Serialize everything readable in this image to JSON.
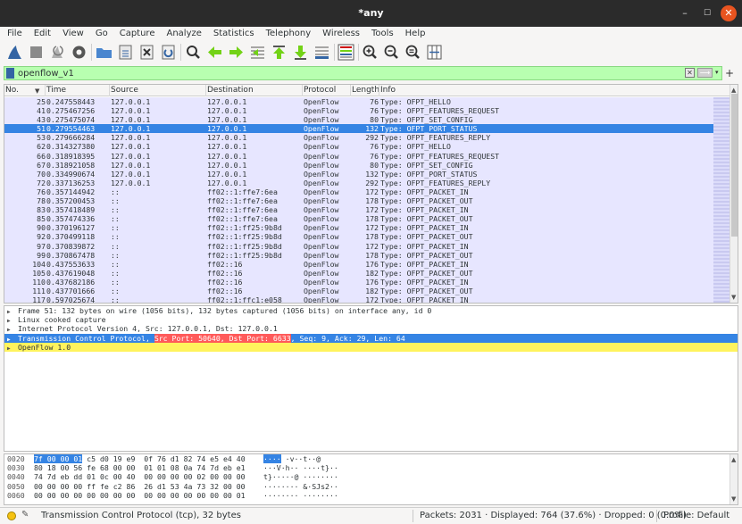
{
  "window": {
    "title": "*any",
    "min": "–",
    "max": "☐",
    "close": "✕"
  },
  "menu": [
    "File",
    "Edit",
    "View",
    "Go",
    "Capture",
    "Analyze",
    "Statistics",
    "Telephony",
    "Wireless",
    "Tools",
    "Help"
  ],
  "filter": {
    "value": "openflow_v1",
    "add": "+",
    "clear": "✕",
    "apply": "⟶",
    "dropdown": "▾"
  },
  "columns": {
    "no": "No.",
    "time": "Time",
    "source": "Source",
    "destination": "Destination",
    "protocol": "Protocol",
    "length": "Length",
    "info": "Info"
  },
  "packets": [
    {
      "no": "25",
      "time": "0.247558443",
      "src": "127.0.0.1",
      "dst": "127.0.0.1",
      "proto": "OpenFlow",
      "len": "76",
      "info": "Type: OFPT_HELLO"
    },
    {
      "no": "41",
      "time": "0.275467256",
      "src": "127.0.0.1",
      "dst": "127.0.0.1",
      "proto": "OpenFlow",
      "len": "76",
      "info": "Type: OFPT_FEATURES_REQUEST"
    },
    {
      "no": "43",
      "time": "0.275475074",
      "src": "127.0.0.1",
      "dst": "127.0.0.1",
      "proto": "OpenFlow",
      "len": "80",
      "info": "Type: OFPT_SET_CONFIG"
    },
    {
      "no": "51",
      "time": "0.279554463",
      "src": "127.0.0.1",
      "dst": "127.0.0.1",
      "proto": "OpenFlow",
      "len": "132",
      "info": "Type: OFPT_PORT_STATUS",
      "selected": true
    },
    {
      "no": "53",
      "time": "0.279666284",
      "src": "127.0.0.1",
      "dst": "127.0.0.1",
      "proto": "OpenFlow",
      "len": "292",
      "info": "Type: OFPT_FEATURES_REPLY"
    },
    {
      "no": "62",
      "time": "0.314327380",
      "src": "127.0.0.1",
      "dst": "127.0.0.1",
      "proto": "OpenFlow",
      "len": "76",
      "info": "Type: OFPT_HELLO"
    },
    {
      "no": "66",
      "time": "0.318918395",
      "src": "127.0.0.1",
      "dst": "127.0.0.1",
      "proto": "OpenFlow",
      "len": "76",
      "info": "Type: OFPT_FEATURES_REQUEST"
    },
    {
      "no": "67",
      "time": "0.318921058",
      "src": "127.0.0.1",
      "dst": "127.0.0.1",
      "proto": "OpenFlow",
      "len": "80",
      "info": "Type: OFPT_SET_CONFIG"
    },
    {
      "no": "70",
      "time": "0.334990674",
      "src": "127.0.0.1",
      "dst": "127.0.0.1",
      "proto": "OpenFlow",
      "len": "132",
      "info": "Type: OFPT_PORT_STATUS"
    },
    {
      "no": "72",
      "time": "0.337136253",
      "src": "127.0.0.1",
      "dst": "127.0.0.1",
      "proto": "OpenFlow",
      "len": "292",
      "info": "Type: OFPT_FEATURES_REPLY"
    },
    {
      "no": "76",
      "time": "0.357144942",
      "src": "::",
      "dst": "ff02::1:ffe7:6ea",
      "proto": "OpenFlow",
      "len": "172",
      "info": "Type: OFPT_PACKET_IN"
    },
    {
      "no": "78",
      "time": "0.357200453",
      "src": "::",
      "dst": "ff02::1:ffe7:6ea",
      "proto": "OpenFlow",
      "len": "178",
      "info": "Type: OFPT_PACKET_OUT"
    },
    {
      "no": "83",
      "time": "0.357418489",
      "src": "::",
      "dst": "ff02::1:ffe7:6ea",
      "proto": "OpenFlow",
      "len": "172",
      "info": "Type: OFPT_PACKET_IN"
    },
    {
      "no": "85",
      "time": "0.357474336",
      "src": "::",
      "dst": "ff02::1:ffe7:6ea",
      "proto": "OpenFlow",
      "len": "178",
      "info": "Type: OFPT_PACKET_OUT"
    },
    {
      "no": "90",
      "time": "0.370196127",
      "src": "::",
      "dst": "ff02::1:ff25:9b8d",
      "proto": "OpenFlow",
      "len": "172",
      "info": "Type: OFPT_PACKET_IN"
    },
    {
      "no": "92",
      "time": "0.370499118",
      "src": "::",
      "dst": "ff02::1:ff25:9b8d",
      "proto": "OpenFlow",
      "len": "178",
      "info": "Type: OFPT_PACKET_OUT"
    },
    {
      "no": "97",
      "time": "0.370839872",
      "src": "::",
      "dst": "ff02::1:ff25:9b8d",
      "proto": "OpenFlow",
      "len": "172",
      "info": "Type: OFPT_PACKET_IN"
    },
    {
      "no": "99",
      "time": "0.370867478",
      "src": "::",
      "dst": "ff02::1:ff25:9b8d",
      "proto": "OpenFlow",
      "len": "178",
      "info": "Type: OFPT_PACKET_OUT"
    },
    {
      "no": "104",
      "time": "0.437553633",
      "src": "::",
      "dst": "ff02::16",
      "proto": "OpenFlow",
      "len": "176",
      "info": "Type: OFPT_PACKET_IN"
    },
    {
      "no": "105",
      "time": "0.437619048",
      "src": "::",
      "dst": "ff02::16",
      "proto": "OpenFlow",
      "len": "182",
      "info": "Type: OFPT_PACKET_OUT"
    },
    {
      "no": "110",
      "time": "0.437682186",
      "src": "::",
      "dst": "ff02::16",
      "proto": "OpenFlow",
      "len": "176",
      "info": "Type: OFPT_PACKET_IN"
    },
    {
      "no": "111",
      "time": "0.437701666",
      "src": "::",
      "dst": "ff02::16",
      "proto": "OpenFlow",
      "len": "182",
      "info": "Type: OFPT_PACKET_OUT"
    },
    {
      "no": "117",
      "time": "0.597025674",
      "src": "::",
      "dst": "ff02::1:ffc1:e058",
      "proto": "OpenFlow",
      "len": "172",
      "info": "Type: OFPT_PACKET_IN"
    }
  ],
  "details": {
    "frame": "Frame 51: 132 bytes on wire (1056 bits), 132 bytes captured (1056 bits) on interface any, id 0",
    "sll": "Linux cooked capture",
    "ip": "Internet Protocol Version 4, Src: 127.0.0.1, Dst: 127.0.0.1",
    "tcp_a": "Transmission Control Protocol, ",
    "tcp_b": "Src Port: 50640, Dst Port: 6633",
    "tcp_c": ", Seq: 9, Ack: 29, Len: 64",
    "openflow": "OpenFlow 1.0"
  },
  "bytes": [
    {
      "off": "0020",
      "sel": "7f 00 00 01",
      "hex": " c5 d0 19 e9  0f 76 d1 82 74 e5 e4 40",
      "asel": "····",
      "asc": "···· ·v··t··@"
    },
    {
      "off": "0030",
      "sel": "",
      "hex": "80 18 00 56 fe 68 00 00  01 01 08 0a 74 7d eb e1",
      "asel": "",
      "asc": "···V·h·· ····t}··"
    },
    {
      "off": "0040",
      "sel": "",
      "hex": "74 7d eb dd 01 0c 00 40  00 00 00 00 02 00 00 00",
      "asel": "",
      "asc": "t}·····@ ········"
    },
    {
      "off": "0050",
      "sel": "",
      "hex": "00 00 00 00 ff fe c2 86  26 d1 53 4a 73 32 00 00",
      "asel": "",
      "asc": "········ &·SJs2··"
    },
    {
      "off": "0060",
      "sel": "",
      "hex": "00 00 00 00 00 00 00 00  00 00 00 00 00 00 00 01",
      "asel": "",
      "asc": "········ ········"
    }
  ],
  "status": {
    "left": "Transmission Control Protocol (tcp), 32 bytes",
    "packets": "Packets: 2031 · Displayed: 764 (37.6%) · Dropped: 0 (0.0%)",
    "profile": "Profile: Default"
  },
  "colors": {
    "accent": "#3584e4",
    "filter_ok": "#b8ffb0",
    "openflow_row": "#e7e6ff",
    "title_bg": "#2b2b2b",
    "close_btn": "#e95420"
  }
}
